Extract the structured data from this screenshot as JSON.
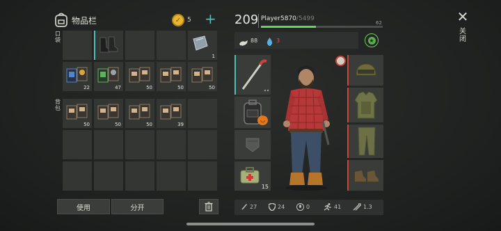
{
  "inventory": {
    "title": "物品栏",
    "coins": "5",
    "pocket_label": "口袋",
    "backpack_label": "背包",
    "pocket_items": [
      {
        "icon": "empty-slot-icon",
        "count": ""
      },
      {
        "icon": "boots-icon",
        "count": ""
      },
      {
        "icon": "empty-slot-icon",
        "count": ""
      },
      {
        "icon": "empty-slot-icon",
        "count": ""
      },
      {
        "icon": "metal-plate-icon",
        "count": "1"
      },
      {
        "icon": "blue-card-pack-icon",
        "count": "22"
      },
      {
        "icon": "green-card-pack-icon",
        "count": "47"
      },
      {
        "icon": "card-pack-icon",
        "count": "50"
      },
      {
        "icon": "card-pack-icon",
        "count": "50"
      },
      {
        "icon": "card-pack-icon",
        "count": "50"
      }
    ],
    "backpack_items": [
      {
        "icon": "card-pack-icon",
        "count": "50"
      },
      {
        "icon": "card-pack-icon",
        "count": "50"
      },
      {
        "icon": "card-pack-icon",
        "count": "50"
      },
      {
        "icon": "card-pack-icon",
        "count": "39"
      }
    ],
    "use_label": "使用",
    "split_label": "分开"
  },
  "player": {
    "level": "209",
    "name": "Player5870",
    "xp_total": "/5499",
    "xp_remaining": "62",
    "xp_progress": 0.45,
    "food": "88",
    "water": "3"
  },
  "equipment": {
    "weapon_count": "",
    "medkit_count": "15"
  },
  "stats": {
    "attack": "27",
    "defense": "24",
    "radiation": "0",
    "speed": "41",
    "attack_speed": "1.3"
  },
  "close_label": "关闭",
  "colors": {
    "xp_bar": "#6bd158",
    "coin": "#e8b730",
    "plus": "#4fc0b8",
    "water": "#5aaee0",
    "water_value": "#e0584a"
  }
}
